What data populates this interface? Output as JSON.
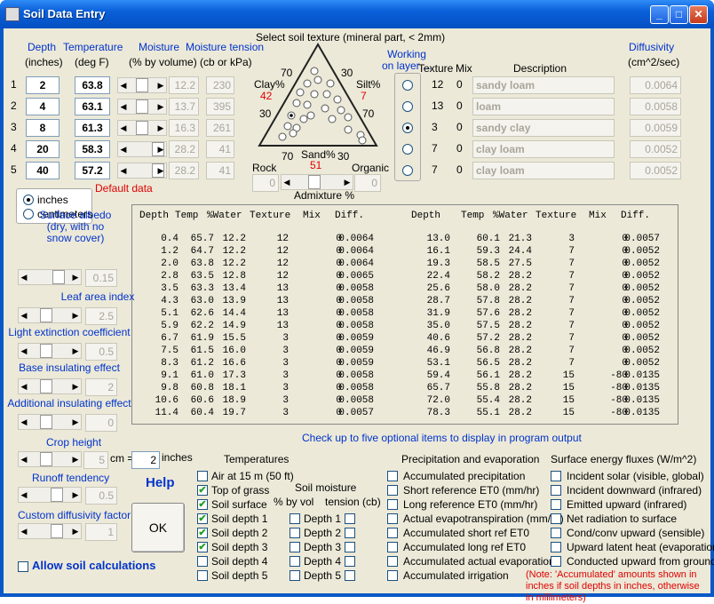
{
  "window": {
    "title": "Soil Data Entry"
  },
  "layer_headers": {
    "depth": "Depth",
    "depth_unit": "(inches)",
    "temperature": "Temperature",
    "temperature_unit": "(deg F)",
    "moisture": "Moisture",
    "moisture_unit": "(% by volume)",
    "tension": "Moisture tension",
    "tension_unit": "(cb or kPa)"
  },
  "layers": [
    {
      "n": "1",
      "depth": "2",
      "temp": "63.8",
      "moisture": "12.2",
      "tension": "230",
      "texture": "12",
      "mix": "0",
      "desc": "sandy loam",
      "diff": "0.0064",
      "selected": false
    },
    {
      "n": "2",
      "depth": "4",
      "temp": "63.1",
      "moisture": "13.7",
      "tension": "395",
      "texture": "13",
      "mix": "0",
      "desc": "loam",
      "diff": "0.0058",
      "selected": false
    },
    {
      "n": "3",
      "depth": "8",
      "temp": "61.3",
      "moisture": "16.3",
      "tension": "261",
      "texture": "3",
      "mix": "0",
      "desc": "sandy clay",
      "diff": "0.0059",
      "selected": true
    },
    {
      "n": "4",
      "depth": "20",
      "temp": "58.3",
      "moisture": "28.2",
      "tension": "41",
      "texture": "7",
      "mix": "0",
      "desc": "clay loam",
      "diff": "0.0052",
      "selected": false
    },
    {
      "n": "5",
      "depth": "40",
      "temp": "57.2",
      "moisture": "28.2",
      "tension": "41",
      "texture": "7",
      "mix": "0",
      "desc": "clay loam",
      "diff": "0.0052",
      "selected": false
    }
  ],
  "triangle": {
    "title": "Select soil texture (mineral part, < 2mm)",
    "clay_label": "Clay%",
    "clay_value": "42",
    "silt_label": "Silt%",
    "silt_value": "7",
    "sand_label": "Sand%",
    "sand_value": "51",
    "tick70a": "70",
    "tick30a": "30",
    "tick30b": "30",
    "tick70b": "70",
    "tick70c": "70",
    "tick30c": "30",
    "rock_label": "Rock",
    "rock_value": "0",
    "organic_label": "Organic",
    "organic_value": "0",
    "admixture_label": "Admixture %"
  },
  "working_on_label": "Working on layer ...",
  "texture_header": "Texture",
  "mix_header": "Mix",
  "description_header": "Description",
  "diffusivity_header": "Diffusivity",
  "diffusivity_unit": "(cm^2/sec)",
  "units": {
    "inches": "inches",
    "centimeters": "centimeters",
    "default_data": "Default data"
  },
  "profile_table": {
    "headers": [
      "Depth",
      "Temp",
      "%Water",
      "Texture",
      "Mix",
      "Diff."
    ],
    "left": [
      [
        "0.4",
        "65.7",
        "12.2",
        "12",
        "0",
        "0.0064"
      ],
      [
        "1.2",
        "64.7",
        "12.2",
        "12",
        "0",
        "0.0064"
      ],
      [
        "2.0",
        "63.8",
        "12.2",
        "12",
        "0",
        "0.0064"
      ],
      [
        "2.8",
        "63.5",
        "12.8",
        "12",
        "0",
        "0.0065"
      ],
      [
        "3.5",
        "63.3",
        "13.4",
        "13",
        "0",
        "0.0058"
      ],
      [
        "4.3",
        "63.0",
        "13.9",
        "13",
        "0",
        "0.0058"
      ],
      [
        "5.1",
        "62.6",
        "14.4",
        "13",
        "0",
        "0.0058"
      ],
      [
        "5.9",
        "62.2",
        "14.9",
        "13",
        "0",
        "0.0058"
      ],
      [
        "6.7",
        "61.9",
        "15.5",
        "3",
        "0",
        "0.0059"
      ],
      [
        "7.5",
        "61.5",
        "16.0",
        "3",
        "0",
        "0.0059"
      ],
      [
        "8.3",
        "61.2",
        "16.6",
        "3",
        "0",
        "0.0059"
      ],
      [
        "9.1",
        "61.0",
        "17.3",
        "3",
        "0",
        "0.0058"
      ],
      [
        "9.8",
        "60.8",
        "18.1",
        "3",
        "0",
        "0.0058"
      ],
      [
        "10.6",
        "60.6",
        "18.9",
        "3",
        "0",
        "0.0058"
      ],
      [
        "11.4",
        "60.4",
        "19.7",
        "3",
        "0",
        "0.0057"
      ]
    ],
    "right": [
      [
        "13.0",
        "60.1",
        "21.3",
        "3",
        "0",
        "0.0057"
      ],
      [
        "16.1",
        "59.3",
        "24.4",
        "7",
        "0",
        "0.0052"
      ],
      [
        "19.3",
        "58.5",
        "27.5",
        "7",
        "0",
        "0.0052"
      ],
      [
        "22.4",
        "58.2",
        "28.2",
        "7",
        "0",
        "0.0052"
      ],
      [
        "25.6",
        "58.0",
        "28.2",
        "7",
        "0",
        "0.0052"
      ],
      [
        "28.7",
        "57.8",
        "28.2",
        "7",
        "0",
        "0.0052"
      ],
      [
        "31.9",
        "57.6",
        "28.2",
        "7",
        "0",
        "0.0052"
      ],
      [
        "35.0",
        "57.5",
        "28.2",
        "7",
        "0",
        "0.0052"
      ],
      [
        "40.6",
        "57.2",
        "28.2",
        "7",
        "0",
        "0.0052"
      ],
      [
        "46.9",
        "56.8",
        "28.2",
        "7",
        "0",
        "0.0052"
      ],
      [
        "53.1",
        "56.5",
        "28.2",
        "7",
        "0",
        "0.0052"
      ],
      [
        "59.4",
        "56.1",
        "28.2",
        "15",
        "-80",
        "0.0135"
      ],
      [
        "65.7",
        "55.8",
        "28.2",
        "15",
        "-80",
        "0.0135"
      ],
      [
        "72.0",
        "55.4",
        "28.2",
        "15",
        "-80",
        "0.0135"
      ],
      [
        "78.3",
        "55.1",
        "28.2",
        "15",
        "-80",
        "0.0135"
      ]
    ]
  },
  "params": [
    {
      "label": "Surface albedo\n(dry, with no\nsnow cover)",
      "value": "0.15"
    },
    {
      "label": "Leaf area index",
      "value": "2.5"
    },
    {
      "label": "Light extinction coefficient",
      "value": "0.5"
    },
    {
      "label": "Base insulating effect",
      "value": "2"
    },
    {
      "label": "Additional insulating effect",
      "value": "0"
    }
  ],
  "crop": {
    "label": "Crop height",
    "cm_value": "5",
    "cm_eq": "cm =",
    "in_value": "2",
    "in_unit": "inches"
  },
  "runoff": {
    "label": "Runoff tendency",
    "value": "0.5"
  },
  "custom_diff": {
    "label": "Custom diffusivity factor",
    "value": "1"
  },
  "help": "Help",
  "ok": "OK",
  "allow_soil": "Allow soil calculations",
  "output_note": "Check up to five optional items to display in program output",
  "temperatures": {
    "title": "Temperatures",
    "items": [
      {
        "label": "Air at 15 m (50 ft)",
        "checked": false
      },
      {
        "label": "Top of grass",
        "checked": true
      },
      {
        "label": "Soil surface",
        "checked": true
      },
      {
        "label": "Soil depth 1",
        "checked": true
      },
      {
        "label": "Soil depth 2",
        "checked": true
      },
      {
        "label": "Soil depth 3",
        "checked": true
      },
      {
        "label": "Soil depth 4",
        "checked": false
      },
      {
        "label": "Soil depth 5",
        "checked": false
      }
    ]
  },
  "soil_moisture": {
    "title": "Soil moisture",
    "by_vol": "% by vol",
    "tension": "tension (cb)",
    "items": [
      "Depth 1",
      "Depth 2",
      "Depth 3",
      "Depth 4",
      "Depth 5"
    ]
  },
  "precip": {
    "title": "Precipitation and evaporation",
    "items": [
      "Accumulated precipitation",
      "Short reference ET0 (mm/hr)",
      "Long reference ET0 (mm/hr)",
      "Actual evapotranspiration (mm/hr)",
      "Accumulated short ref ET0",
      "Accumulated long ref ET0",
      "Accumulated actual evaporation",
      "Accumulated irrigation"
    ]
  },
  "fluxes": {
    "title": "Surface energy fluxes (W/m^2)",
    "items": [
      "Incident solar (visible, global)",
      "Incident downward (infrared)",
      "Emitted upward (infrared)",
      "Net radiation to surface",
      "Cond/conv upward (sensible)",
      "Upward latent heat  (evaporation)",
      "Conducted upward from ground"
    ]
  },
  "note": "(Note: 'Accumulated' amounts shown in inches if soil depths in inches, otherwise in millimeters)"
}
